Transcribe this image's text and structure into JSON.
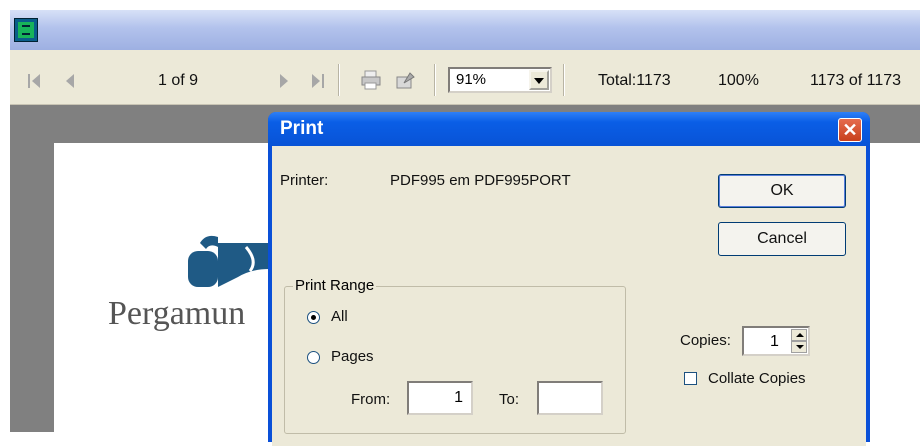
{
  "toolbar": {
    "page_indicator": "1 of 9",
    "zoom_value": "91%",
    "total": "Total:1173",
    "percent": "100%",
    "record_count": "1173 of 1173"
  },
  "report": {
    "logo_text": "Pergamun"
  },
  "dialog": {
    "title": "Print",
    "printer_label": "Printer:",
    "printer_name": "PDF995 em PDF995PORT",
    "ok_label": "OK",
    "cancel_label": "Cancel",
    "range_group_label": "Print Range",
    "all_label": "All",
    "pages_label": "Pages",
    "from_label": "From:",
    "from_value": "1",
    "to_label": "To:",
    "to_value": "",
    "copies_label": "Copies:",
    "copies_value": "1",
    "collate_label": "Collate Copies",
    "selected_range": "All",
    "collate_checked": false
  },
  "icons": [
    "first-page-icon",
    "prev-page-icon",
    "next-page-icon",
    "last-page-icon",
    "printer-icon",
    "export-icon",
    "app-icon",
    "close-icon"
  ]
}
